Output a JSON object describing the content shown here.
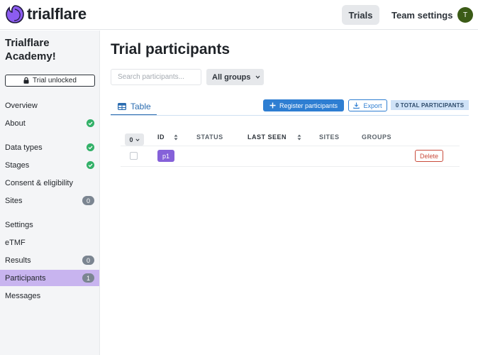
{
  "app": {
    "name": "trialflare"
  },
  "topnav": {
    "trials": "Trials",
    "team_settings": "Team settings",
    "avatar_initial": "T"
  },
  "sidebar": {
    "org_name": "Trialflare Academy!",
    "trial_status": "Trial unlocked",
    "items": [
      {
        "label": "Overview"
      },
      {
        "label": "About",
        "complete": true
      },
      {
        "label": "Data types",
        "complete": true
      },
      {
        "label": "Stages",
        "complete": true
      },
      {
        "label": "Consent & eligibility"
      },
      {
        "label": "Sites",
        "count": "0"
      },
      {
        "label": "Settings"
      },
      {
        "label": "eTMF"
      },
      {
        "label": "Results",
        "count": "0"
      },
      {
        "label": "Participants",
        "count": "1",
        "active": true
      },
      {
        "label": "Messages"
      }
    ]
  },
  "main": {
    "title": "Trial participants",
    "search_placeholder": "Search participants...",
    "group_filter": "All groups",
    "tab_table": "Table",
    "register_button": "Register participants",
    "export_button": "Export",
    "total_badge": "0 TOTAL PARTICIPANTS",
    "table": {
      "selected_count": "0",
      "columns": [
        "ID",
        "STATUS",
        "LAST SEEN",
        "SITES",
        "GROUPS"
      ],
      "rows": [
        {
          "id": "p1",
          "status": "",
          "last_seen": "",
          "sites": "",
          "groups": "",
          "delete_label": "Delete"
        }
      ]
    }
  },
  "colors": {
    "accent": "#2e7ed2",
    "active_nav": "#c8b4ef",
    "id_pill": "#8561d9",
    "success": "#34b169",
    "danger": "#c94c3c"
  }
}
